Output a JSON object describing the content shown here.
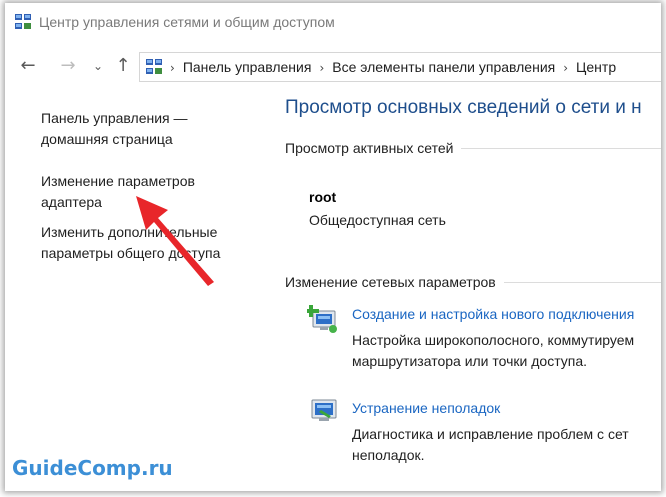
{
  "window": {
    "title": "Центр управления сетями и общим доступом"
  },
  "nav": {
    "back_icon": "arrow-left-icon",
    "forward_icon": "arrow-right-icon",
    "recent_icon": "chevron-down-icon",
    "up_icon": "arrow-up-icon"
  },
  "breadcrumb": {
    "items": [
      "Панель управления",
      "Все элементы панели управления",
      "Центр"
    ]
  },
  "sidebar": {
    "items": [
      {
        "label": "Панель управления — домашняя страница"
      },
      {
        "label": "Изменение параметров адаптера"
      },
      {
        "label": "Изменить дополнительные параметры общего доступа"
      }
    ]
  },
  "main": {
    "title": "Просмотр основных сведений о сети и н",
    "active_networks_heading": "Просмотр активных сетей",
    "network": {
      "name": "root",
      "type": "Общедоступная сеть"
    },
    "change_settings_heading": "Изменение сетевых параметров",
    "tasks": [
      {
        "link": "Создание и настройка нового подключения",
        "desc_line1": "Настройка широкополосного, коммутируем",
        "desc_line2": "маршрутизатора или точки доступа."
      },
      {
        "link": "Устранение неполадок",
        "desc_line1": "Диагностика и исправление проблем с сет",
        "desc_line2": "неполадок."
      }
    ]
  },
  "watermark": {
    "text": "GuideComp.ru"
  },
  "colors": {
    "link_blue": "#1a66c2",
    "title_blue": "#1e4e8c",
    "arrow_red": "#e8262a",
    "watermark_blue": "#3c8fd6"
  }
}
